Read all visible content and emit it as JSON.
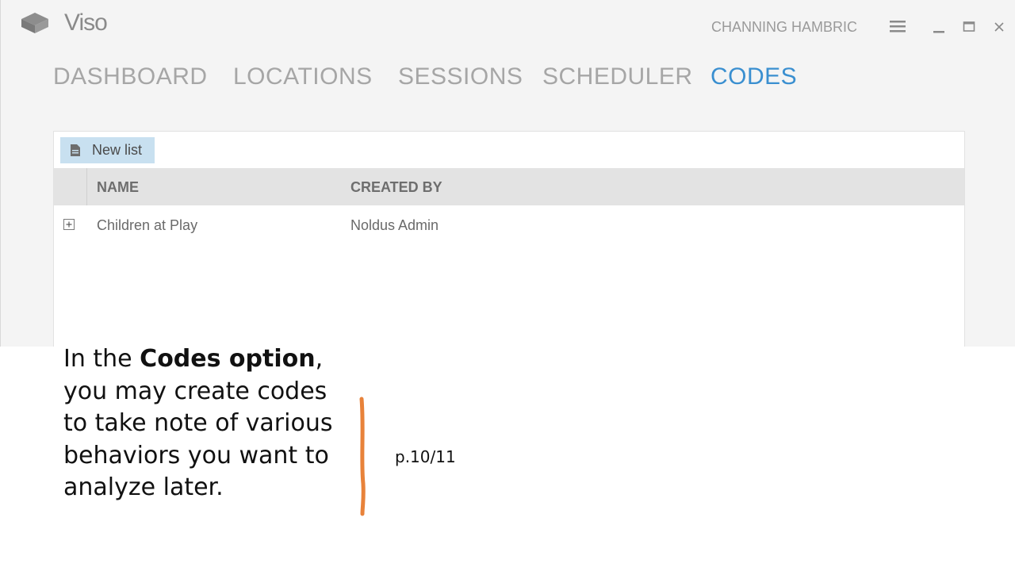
{
  "app": {
    "name": "Viso",
    "user": "CHANNING HAMBRIC"
  },
  "nav": {
    "tabs": [
      {
        "label": "DASHBOARD",
        "active": false
      },
      {
        "label": "LOCATIONS",
        "active": false
      },
      {
        "label": "SESSIONS",
        "active": false
      },
      {
        "label": "SCHEDULER",
        "active": false
      },
      {
        "label": "CODES",
        "active": true
      }
    ]
  },
  "toolbar": {
    "new_list_label": "New list",
    "new_list_icon": "document-icon"
  },
  "grid": {
    "columns": [
      "NAME",
      "CREATED BY"
    ],
    "rows": [
      {
        "name": "Children at Play",
        "created_by": "Noldus Admin"
      }
    ]
  },
  "caption": {
    "prefix": "In the ",
    "bold": "Codes option",
    "suffix": ", you may create codes to take note of various behaviors you want to analyze later."
  },
  "page_number": "p.10/11",
  "colors": {
    "accent_blue": "#3a8fd0",
    "button_bg": "#c8e0f0",
    "accent_orange": "#e8823a"
  }
}
